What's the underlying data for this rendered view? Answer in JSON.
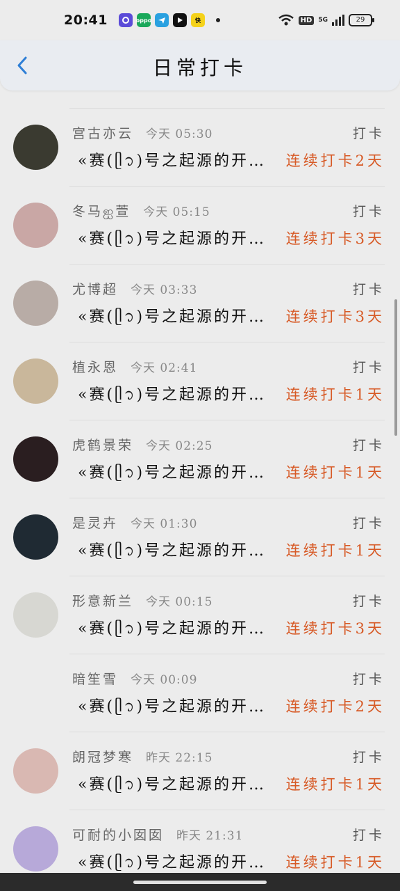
{
  "status_bar": {
    "time": "20:41",
    "apps": [
      {
        "icon": "app-circle-icon",
        "color": "#5b4bd8",
        "label": ""
      },
      {
        "icon": "oppo-icon",
        "color": "#1aa85a",
        "label": "oppo"
      },
      {
        "icon": "telegram-icon",
        "color": "#2aa1e0",
        "label": ""
      },
      {
        "icon": "arrow-app-icon",
        "color": "#111111",
        "label": ""
      },
      {
        "icon": "kuaishou-icon",
        "color": "#f5d21a",
        "label": "快"
      }
    ],
    "hd": "HD",
    "net": "5G",
    "battery": "29"
  },
  "header": {
    "title": "日常打卡"
  },
  "checkins": [
    {
      "name": "宫古亦云",
      "time": "今天 05:30",
      "tag": "打卡",
      "content": "«赛(ᥫ᭡)号之起源的开…",
      "streak": "连续打卡2天",
      "avatar": "#3a3a30"
    },
    {
      "name": "冬马ஐ萱",
      "time": "今天 05:15",
      "tag": "打卡",
      "content": "«赛(ᥫ᭡)号之起源的开…",
      "streak": "连续打卡3天",
      "avatar": "#c9a7a5"
    },
    {
      "name": "尤博超",
      "time": "今天 03:33",
      "tag": "打卡",
      "content": "«赛(ᥫ᭡)号之起源的开…",
      "streak": "连续打卡3天",
      "avatar": "#b8aca6"
    },
    {
      "name": "植永恩",
      "time": "今天 02:41",
      "tag": "打卡",
      "content": "«赛(ᥫ᭡)号之起源的开…",
      "streak": "连续打卡1天",
      "avatar": "#c9b79b"
    },
    {
      "name": "虎鹤景荣",
      "time": "今天 02:25",
      "tag": "打卡",
      "content": "«赛(ᥫ᭡)号之起源的开…",
      "streak": "连续打卡1天",
      "avatar": "#2a1e20"
    },
    {
      "name": "是灵卉",
      "time": "今天 01:30",
      "tag": "打卡",
      "content": "«赛(ᥫ᭡)号之起源的开…",
      "streak": "连续打卡1天",
      "avatar": "#1f2a33"
    },
    {
      "name": "形意新兰",
      "time": "今天 00:15",
      "tag": "打卡",
      "content": "«赛(ᥫ᭡)号之起源的开…",
      "streak": "连续打卡3天",
      "avatar": "#d7d7d2"
    },
    {
      "name": "暗笙雪",
      "time": "今天 00:09",
      "tag": "打卡",
      "content": "«赛(ᥫ᭡)号之起源的开…",
      "streak": "连续打卡2天",
      "avatar": "#ececec"
    },
    {
      "name": "朗冠梦寒",
      "time": "昨天 22:15",
      "tag": "打卡",
      "content": "«赛(ᥫ᭡)号之起源的开…",
      "streak": "连续打卡1天",
      "avatar": "#d9b8b2"
    },
    {
      "name": "可耐的小囡囡",
      "time": "昨天 21:31",
      "tag": "打卡",
      "content": "«赛(ᥫ᭡)号之起源的开…",
      "streak": "连续打卡1天",
      "avatar": "#b7a9d9"
    }
  ]
}
